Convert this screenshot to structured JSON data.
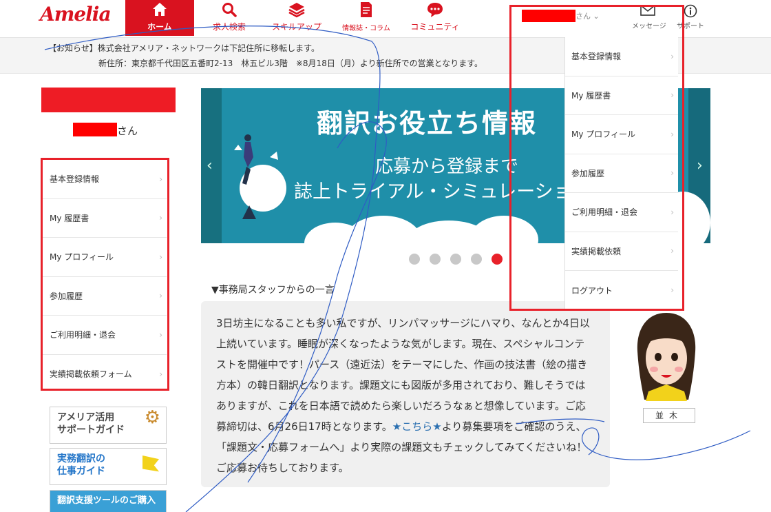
{
  "logo": "Amelia",
  "nav": [
    {
      "label": "ホーム",
      "icon": "home-icon"
    },
    {
      "label": "求人検索",
      "icon": "search-icon"
    },
    {
      "label": "スキルアップ",
      "icon": "layers-icon"
    },
    {
      "label": "情報誌・コラム",
      "icon": "document-icon"
    },
    {
      "label": "コミュニティ",
      "icon": "chat-icon"
    }
  ],
  "header": {
    "user_suffix": "さん",
    "message_label": "メッセージ",
    "support_label": "サポート"
  },
  "notice": {
    "line1": "【お知らせ】株式会社アメリア・ネットワークは下記住所に移転します。",
    "line2": "新住所：東京都千代田区五番町2-13　林五ビル3階　※8月18日（月）より新住所での営業となります。"
  },
  "sidebar": {
    "user_suffix": "さん",
    "items": [
      "基本登録情報",
      "My 履歴書",
      "My プロフィール",
      "参加履歴",
      "ご利用明細・退会",
      "実績掲載依頼フォーム"
    ],
    "guides": [
      {
        "line1": "アメリア活用",
        "line2": "サポートガイド"
      },
      {
        "line1": "実務翻訳の",
        "line2": "仕事ガイド"
      },
      {
        "line1": "翻訳支援ツールのご購入",
        "line2": ""
      }
    ]
  },
  "banner": {
    "title": "翻訳お役立ち情報",
    "sub1": "応募から登録まで",
    "sub2": "誌上トライアル・シミュレーション"
  },
  "carousel": {
    "slide_count": 5,
    "active_index": 5
  },
  "staff": {
    "heading": "▼事務局スタッフからの一言",
    "text_before_link": "3日坊主になることも多い私ですが、リンパマッサージにハマり、なんとか4日以上続いています。睡眠が深くなったような気がします。現在、スペシャルコンテストを開催中です！パース（遠近法）をテーマにした、作画の技法書（絵の描き方本）の韓日翻訳となります。課題文にも図版が多用されており、難しそうではありますが、これを日本語で読めたら楽しいだろうなぁと想像しています。ご応募締切は、6月26日17時となります。",
    "link_text": "★こちら★",
    "text_after_link": "より募集要項をご確認のうえ、「課題文・応募フォームへ」より実際の課題文もチェックしてみてくださいね！ご応募お待ちしております。",
    "staff_name": "並木"
  },
  "dropdown": {
    "items": [
      "基本登録情報",
      "My 履歴書",
      "My プロフィール",
      "参加履歴",
      "ご利用明細・退会",
      "実績掲載依頼",
      "ログアウト"
    ]
  },
  "colors": {
    "brand_red": "#d9121f",
    "highlight_red": "#e8212a",
    "banner_teal": "#1f8fa9"
  }
}
